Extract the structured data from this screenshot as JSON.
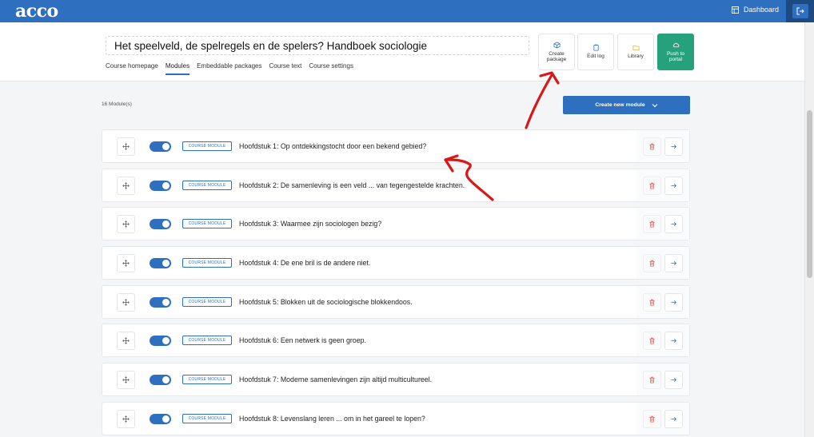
{
  "app": {
    "logo": "acco",
    "dashboard_label": "Dashboard"
  },
  "course": {
    "title": "Het speelveld, de spelregels en de spelers? Handboek sociologie",
    "tabs": [
      {
        "label": "Course homepage",
        "active": false
      },
      {
        "label": "Modules",
        "active": true
      },
      {
        "label": "Embeddable packages",
        "active": false
      },
      {
        "label": "Course text",
        "active": false
      },
      {
        "label": "Course settings",
        "active": false
      }
    ]
  },
  "actions": {
    "create_package": "Create package",
    "edit_log": "Edit log",
    "library": "Library",
    "push_to_portal": "Push to portal"
  },
  "modules": {
    "count_label": "16 Module(s)",
    "create_button": "Create new module",
    "items": [
      {
        "tag": "COURSE MODULE",
        "title": "Hoofdstuk 1: Op ontdekkingstocht door een bekend gebied?"
      },
      {
        "tag": "COURSE MODULE",
        "title": "Hoofdstuk 2: De samenleving is een veld ... van tegengestelde krachten."
      },
      {
        "tag": "COURSE MODULE",
        "title": "Hoofdstuk 3: Waarmee zijn sociologen bezig?"
      },
      {
        "tag": "COURSE MODULE",
        "title": "Hoofdstuk 4: De ene bril is de andere niet."
      },
      {
        "tag": "COURSE MODULE",
        "title": "Hoofdstuk 5: Blokken uit de sociologische blokkendoos."
      },
      {
        "tag": "COURSE MODULE",
        "title": "Hoofdstuk 6: Een netwerk is geen groep."
      },
      {
        "tag": "COURSE MODULE",
        "title": "Hoofdstuk 7: Moderne samenlevingen zijn altijd multicultureel."
      },
      {
        "tag": "COURSE MODULE",
        "title": "Hoofdstuk 8: Levenslang leren ... om in het gareel te lopen?"
      }
    ]
  },
  "colors": {
    "primary": "#2f6fc0",
    "navy": "#1e4a82",
    "green": "#25a27b",
    "danger": "#e05555",
    "annotation": "#d81818"
  }
}
